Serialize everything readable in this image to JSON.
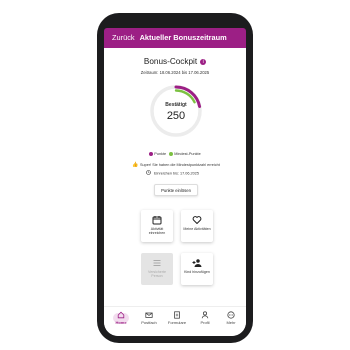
{
  "header": {
    "back_label": "Zurück",
    "title": "Aktueller Bonuszeitraum"
  },
  "cockpit": {
    "title": "Bonus-Cockpit",
    "info_icon": "info-icon",
    "period": "Zeitraum: 18.06.2024 bis 17.06.2025",
    "status_label": "Bestätigt",
    "points_value": "250"
  },
  "legend": {
    "points": "Punkte",
    "minimum": "Mindest-Punkte"
  },
  "messages": {
    "minimum_reached": "Super! Sie haben die Mindestpunktzahl erreicht",
    "submit_deadline": "Einreichen bis: 17.06.2025"
  },
  "actions": {
    "submit_points": "Punkte einlösen"
  },
  "tiles": [
    {
      "label": "Aktivität einreichen",
      "icon": "calendar-icon"
    },
    {
      "label": "Meine Aktivitäten",
      "icon": "heart-icon"
    },
    {
      "label": "Versicherte Person",
      "icon": "list-icon"
    },
    {
      "label": "Kind hinzufügen",
      "icon": "add-person-icon"
    }
  ],
  "nav": [
    {
      "label": "Home",
      "icon": "home-icon"
    },
    {
      "label": "Postfach",
      "icon": "mail-icon"
    },
    {
      "label": "Formulare",
      "icon": "document-icon"
    },
    {
      "label": "Profil",
      "icon": "person-icon"
    },
    {
      "label": "Mehr",
      "icon": "more-icon"
    }
  ],
  "colors": {
    "brand": "#9c1f85",
    "points": "#9c1f85",
    "minimum": "#7cc142",
    "ring_track": "#ececec"
  },
  "progress": {
    "points_fraction": 0.22,
    "minimum_fraction": 0.18
  }
}
